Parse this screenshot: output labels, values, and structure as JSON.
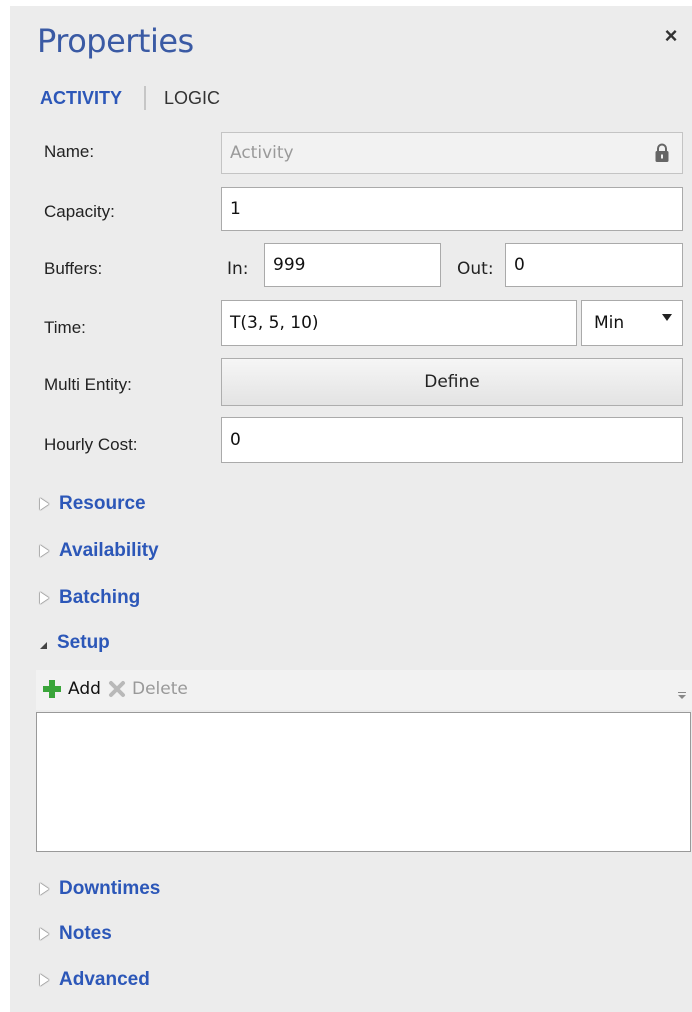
{
  "header": {
    "title": "Properties",
    "close_icon": "close-icon"
  },
  "tabs": [
    {
      "label": "ACTIVITY",
      "active": true
    },
    {
      "label": "LOGIC",
      "active": false
    }
  ],
  "form": {
    "name": {
      "label": "Name:",
      "value": "Activity",
      "locked": true
    },
    "capacity": {
      "label": "Capacity:",
      "value": "1"
    },
    "buffers": {
      "label": "Buffers:",
      "in_label": "In:",
      "in_value": "999",
      "out_label": "Out:",
      "out_value": "0"
    },
    "time": {
      "label": "Time:",
      "value": "T(3, 5, 10)",
      "unit": "Min"
    },
    "multi_entity": {
      "label": "Multi Entity:",
      "button": "Define"
    },
    "hourly_cost": {
      "label": "Hourly Cost:",
      "value": "0"
    }
  },
  "sections": {
    "resource": "Resource",
    "availability": "Availability",
    "batching": "Batching",
    "setup": "Setup",
    "downtimes": "Downtimes",
    "notes": "Notes",
    "advanced": "Advanced"
  },
  "setup_toolbar": {
    "add": "Add",
    "delete": "Delete"
  },
  "colors": {
    "accent": "#2c57b8",
    "title": "#3a5aa4",
    "add_green": "#3aa53a",
    "panel_bg": "#ececec"
  }
}
